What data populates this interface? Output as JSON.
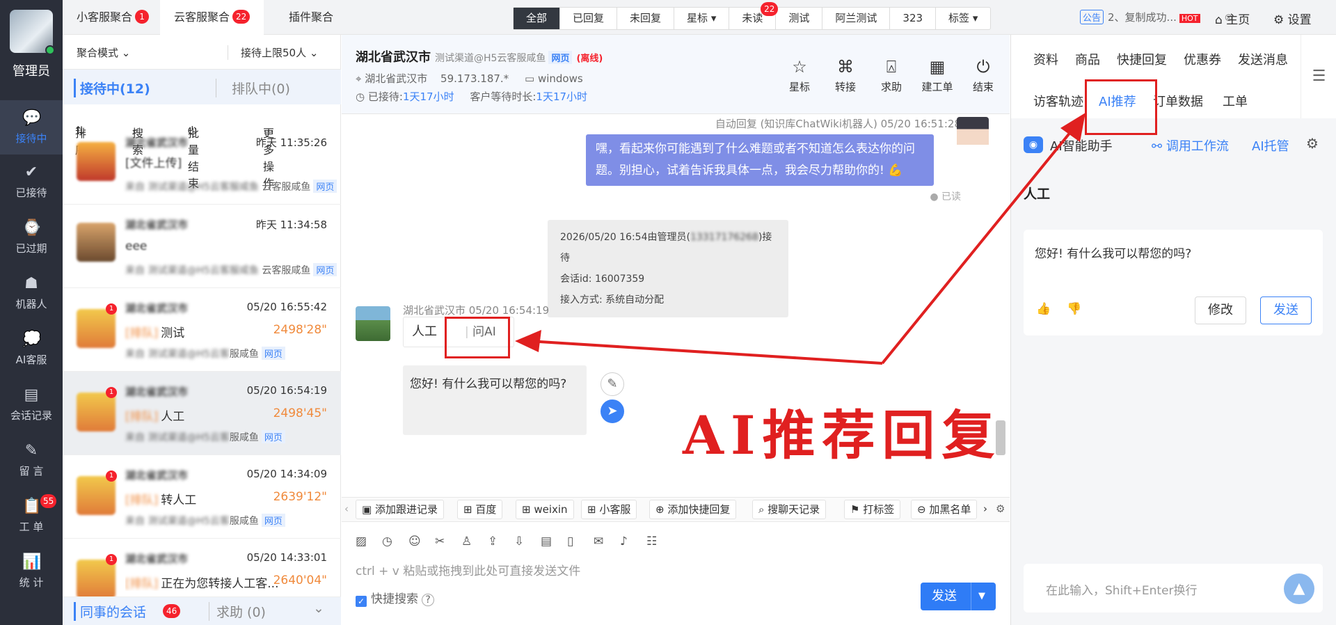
{
  "user": {
    "name": "管理员"
  },
  "leftnav": [
    {
      "label": "接待中",
      "icon": "chat-bubble-icon",
      "active": true
    },
    {
      "label": "已接待",
      "icon": "check-circle-icon"
    },
    {
      "label": "已过期",
      "icon": "expired-chat-icon"
    },
    {
      "label": "机器人",
      "icon": "robot-icon"
    },
    {
      "label": "AI客服",
      "icon": "ai-chat-icon"
    },
    {
      "label": "会话记录",
      "icon": "chat-record-icon"
    },
    {
      "label": "留 言",
      "icon": "message-icon"
    },
    {
      "label": "工 单",
      "icon": "ticket-icon",
      "badge": "55"
    },
    {
      "label": "统 计",
      "icon": "stats-icon"
    }
  ],
  "topbar": {
    "tabs": [
      {
        "label": "小客服聚合",
        "badge": "1"
      },
      {
        "label": "云客服聚合",
        "badge": "22",
        "active": true
      },
      {
        "label": "插件聚合"
      }
    ],
    "filters": [
      "全部",
      "已回复",
      "未回复",
      "星标 ▾",
      "未读",
      "测试",
      "阿兰测试",
      "323",
      "标签 ▾"
    ],
    "unread_badge": "22",
    "notice_tag": "公告",
    "notice_text": "2、复制成功...",
    "home": "主页",
    "settings": "设置"
  },
  "sessions": {
    "mode": "聚合模式",
    "limit": "接待上限50人",
    "tab_active": "接待中(12)",
    "tab_queue": "排队中(0)",
    "actions": [
      "排序",
      "搜索",
      "批量结束",
      "更多操作"
    ],
    "items": [
      {
        "name": "湖北省武汉市",
        "time": "昨天 11:35:26",
        "msg": "[文件上传]",
        "src": "来自 测试渠道@H5云客服咸鱼",
        "src_tail": "云客服咸鱼",
        "web": "网页"
      },
      {
        "name": "湖北省武汉市",
        "time": "昨天 11:34:58",
        "msg": "eee",
        "src": "来自 测试渠道@H5云客服咸鱼",
        "src_tail": "云客服咸鱼",
        "web": "网页"
      },
      {
        "name": "湖北省武汉市",
        "time": "05/20 16:55:42",
        "msg": "测试",
        "prefix": "[排队]",
        "wait": "2498'28\"",
        "src_tail": "服咸鱼",
        "web": "网页"
      },
      {
        "name": "湖北省武汉市",
        "time": "05/20 16:54:19",
        "msg": "人工",
        "prefix": "[排队]",
        "wait": "2498'45\"",
        "src_tail": "服咸鱼",
        "web": "网页"
      },
      {
        "name": "湖北省武汉市",
        "time": "05/20 14:34:09",
        "msg": "转人工",
        "prefix": "[排队]",
        "wait": "2639'12\"",
        "src_tail": "服咸鱼",
        "web": "网页"
      },
      {
        "name": "湖北省武汉市",
        "time": "05/20 14:33:01",
        "msg": "正在为您转接人工客...",
        "prefix": "[排队]",
        "wait": "2640'04\"",
        "src_tail": "",
        "web": ""
      }
    ],
    "colleague": "同事的会话",
    "colleague_badge": "46",
    "help": "求助 (0)"
  },
  "chat": {
    "title": "湖北省武汉市",
    "channel": "测试渠道@H5云客服咸鱼",
    "web": "网页",
    "offline": "(离线)",
    "location": "湖北省武汉市",
    "ip": "59.173.187.*",
    "os": "windows",
    "served_label": "已接待:",
    "served_value": "1天17小时",
    "wait_label": "客户等待时长:",
    "wait_value": "1天17小时",
    "head_buttons": [
      {
        "label": "星标",
        "icon": "star-icon"
      },
      {
        "label": "转接",
        "icon": "transfer-icon"
      },
      {
        "label": "求助",
        "icon": "help-icon"
      },
      {
        "label": "建工单",
        "icon": "ticket-create-icon"
      },
      {
        "label": "结束",
        "icon": "power-icon"
      }
    ],
    "bot_caption": "自动回复 (知识库ChatWiki机器人) 05/20 16:51:28",
    "bot_message": "嘿，看起来你可能遇到了什么难题或者不知道怎么表达你的问题。别担心，试着告诉我具体一点，我会尽力帮助你的! 💪",
    "read": "● 已读",
    "sys_line1": "2026/05/20 16:54由管理员(",
    "sys_hidden": "13317176268",
    "sys_line1_end": ")接待",
    "sys_line2": "会话id: 16007359",
    "sys_line3": "接入方式: 系统自动分配",
    "visitor_caption": "湖北省武汉市 05/20 16:54:19",
    "visitor_msg": "人工",
    "ask_ai": "问AI",
    "suggest": "您好! 有什么我可以帮您的吗?",
    "annotation": "AI推荐回复",
    "tools": [
      "添加跟进记录",
      "百度",
      "weixin",
      "小客服",
      "添加快捷回复",
      "搜聊天记录",
      "打标签",
      "加黑名单"
    ],
    "placeholder": "ctrl + v 粘贴或拖拽到此处可直接发送文件",
    "quick_search": "快捷搜索",
    "send": "发送"
  },
  "right": {
    "tabs_row1": [
      "资料",
      "商品",
      "快捷回复",
      "优惠券",
      "发送消息"
    ],
    "tabs_row2": [
      "访客轨迹",
      "AI推荐",
      "订单数据",
      "工单"
    ],
    "ai_title": "AI智能助手",
    "workflow": "调用工作流",
    "ai_host": "AI托管",
    "query": "人工",
    "answer": "您好! 有什么我可以帮您的吗?",
    "edit": "修改",
    "send": "发送",
    "input_placeholder": "在此输入，Shift+Enter换行"
  }
}
